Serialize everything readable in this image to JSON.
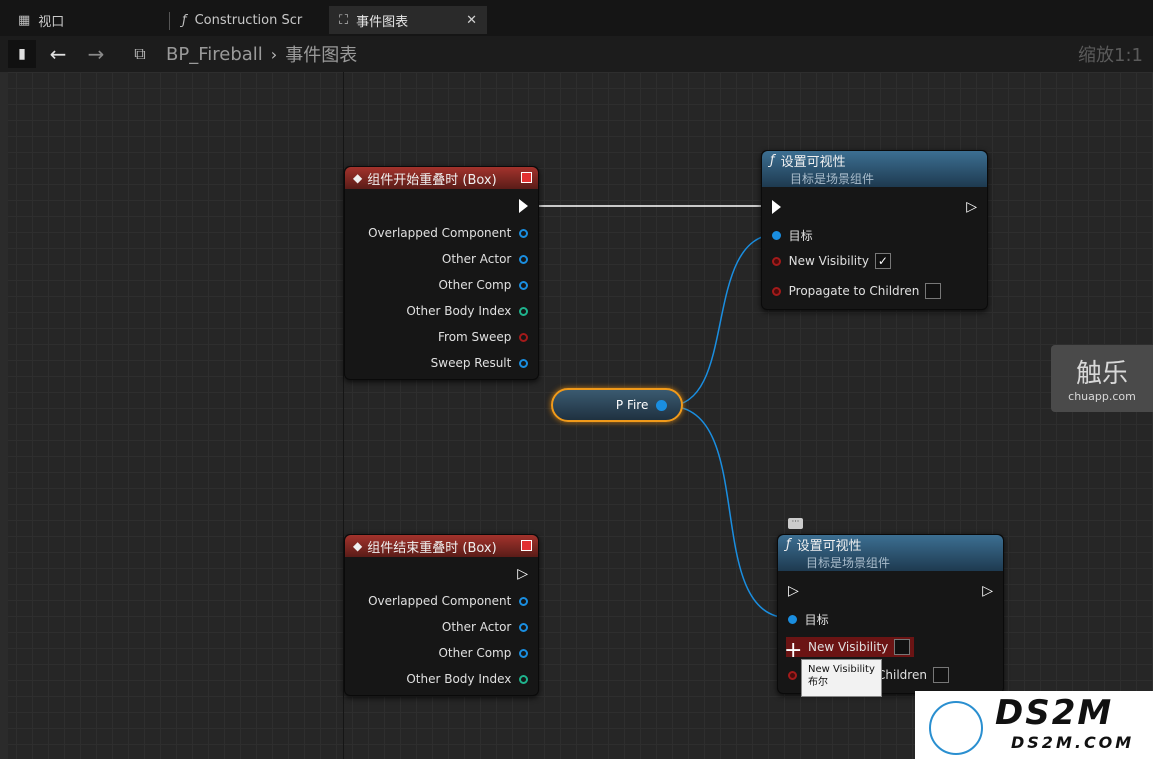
{
  "tabs": [
    {
      "label": "视口",
      "icon": "viewport-icon"
    },
    {
      "label": "Construction Scr",
      "icon": "function-icon"
    },
    {
      "label": "事件图表",
      "icon": "event-graph-icon",
      "close": "✕"
    }
  ],
  "toolbar": {
    "breadcrumb_root": "BP_Fireball",
    "breadcrumb_sep": "›",
    "breadcrumb_current": "事件图表",
    "zoom": "缩放1:1"
  },
  "nodes": {
    "begin_overlap": {
      "title": "组件开始重叠时 (Box)",
      "pins": [
        "Overlapped Component",
        "Other Actor",
        "Other Comp",
        "Other Body Index",
        "From Sweep",
        "Sweep Result"
      ]
    },
    "set_vis_1": {
      "title": "设置可视性",
      "subtitle": "目标是场景组件",
      "target": "目标",
      "new_visibility": "New Visibility",
      "new_visibility_checked": "✓",
      "propagate": "Propagate to Children"
    },
    "pfire": {
      "label": "P Fire"
    },
    "end_overlap": {
      "title": "组件结束重叠时 (Box)",
      "pins": [
        "Overlapped Component",
        "Other Actor",
        "Other Comp",
        "Other Body Index"
      ]
    },
    "set_vis_2": {
      "title": "设置可视性",
      "subtitle": "目标是场景组件",
      "target": "目标",
      "new_visibility": "New Visibility",
      "propagate_tail": "Children"
    }
  },
  "tooltip": {
    "line1": "New Visibility",
    "line2": "布尔"
  },
  "watermarks": {
    "chuapp_cn": "触乐",
    "chuapp_url": "chuapp.com",
    "ds2m": "DS2M",
    "ds2m_url": "DS2M.COM"
  },
  "colors": {
    "exec": "#ffffff",
    "object_pin": "#1a8ee0",
    "int_pin": "#1fb38d",
    "bool_pin": "#a31a1a",
    "highlight": "#f19a1a"
  }
}
